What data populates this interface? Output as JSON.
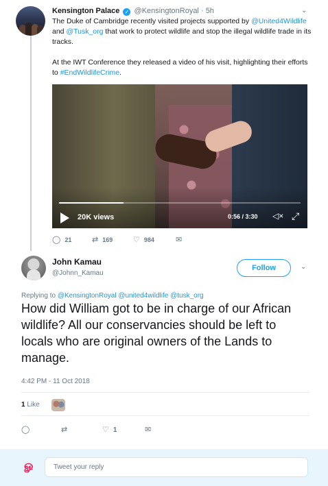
{
  "original_tweet": {
    "author_name": "Kensington Palace",
    "verified_mark": "✓",
    "author_handle": "@KensingtonRoyal",
    "separator": "·",
    "time_ago": "5h",
    "paragraph1": {
      "t1": "The Duke of Cambridge recently visited projects supported by ",
      "link1": "@United4Wildlife",
      "t2": " and ",
      "link2": "@Tusk_org",
      "t3": " that work to protect wildlife and stop the illegal wildlife trade in its tracks."
    },
    "paragraph2": {
      "t1": "At the IWT Conference they released a video of his visit, highlighting their efforts to ",
      "link1": "#EndWildlifeCrime",
      "t2": "."
    },
    "video": {
      "views": "20K views",
      "time": "0:56 / 3:30",
      "progress_fraction": 0.2667
    },
    "actions": {
      "replies": "21",
      "retweets": "169",
      "likes": "984"
    }
  },
  "reply_tweet": {
    "author_name": "John Kamau",
    "author_handle": "@Johnn_Kamau",
    "follow_label": "Follow",
    "replying_prefix": "Replying to ",
    "replying_handles": "@KensingtonRoyal @united4wildlife @tusk_org",
    "text": "How did William got to be in charge of our African wildlife? All our conservancies should be left to locals who are original owners of the Lands to manage.",
    "timestamp": "4:42 PM - 11 Oct 2018",
    "likes_count": "1",
    "likes_label": "Like",
    "actions": {
      "likes": "1"
    }
  },
  "composer": {
    "placeholder": "Tweet your reply"
  },
  "icons": {
    "caret": "⌄",
    "reply": "💬",
    "retweet": "⇄",
    "like": "♡",
    "message": "✉",
    "play": "▶",
    "volume": "🔇",
    "fullscreen": "⤢"
  },
  "colors": {
    "link": "#1b95e0",
    "accent": "#1da1f2",
    "muted": "#657786"
  }
}
